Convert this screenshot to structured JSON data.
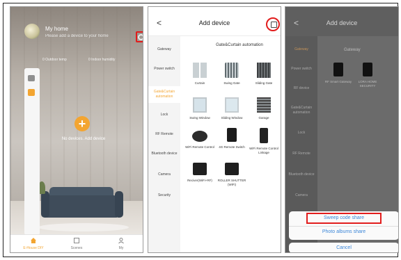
{
  "screen1": {
    "home_name": "My home",
    "home_subtitle": "Please add a device to your home",
    "stat_left": "0 Outdoor temp",
    "stat_right": "0 Indoor humidity",
    "empty_text": "No devices. Add device",
    "tabs": [
      {
        "label": "E-House DIY",
        "icon": "home-icon"
      },
      {
        "label": "Scenes",
        "icon": "scenes-icon"
      },
      {
        "label": "My",
        "icon": "user-icon"
      }
    ],
    "accent": "#f3a531",
    "highlight_color": "#e21c1c"
  },
  "screen2": {
    "back": "<",
    "title": "Add device",
    "categories": [
      "Gateway",
      "Power switch",
      "Gate&Curtain automation",
      "Lock",
      "RF Remote",
      "Bluetooth device",
      "Camera",
      "Security"
    ],
    "active_category": "Gate&Curtain automation",
    "section_title": "Gate&Curtain automation",
    "devices": [
      "Curtain",
      "Swing Gate",
      "Sliding Gate",
      "Swing Window",
      "Sliding Window",
      "Garage",
      "WiFi Remote Control",
      "4G Remote Switch",
      "WiFi Remote Control Linkage",
      "Reciver(WiFi+RF)",
      "ROLLER SHUTTER (WiFi)"
    ]
  },
  "screen3": {
    "back": "<",
    "title": "Add device",
    "categories": [
      "Gateway",
      "Power switch",
      "RF device",
      "Gate&Curtain automation",
      "Lock",
      "RF Remote",
      "Bluetooth device",
      "Camera"
    ],
    "section_title": "Gateway",
    "devices": [
      "RF Smart Gateway",
      "LORA HOME SECURITY"
    ],
    "sheet": {
      "sweep": "Sweep code share",
      "photos": "Photo albums share",
      "cancel": "Cancel"
    }
  }
}
